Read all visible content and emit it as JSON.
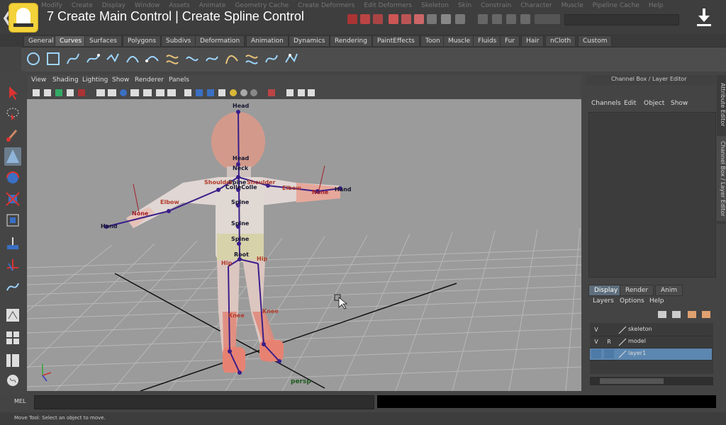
{
  "top_menu": [
    "Modify",
    "Create",
    "Display",
    "Window",
    "Assets",
    "Animate",
    "Geometry Cache",
    "Create Deformers",
    "Edit Deformers",
    "Skeleton",
    "Skin",
    "Constrain",
    "Character",
    "Muscle",
    "Pipeline Cache",
    "Help"
  ],
  "video": {
    "back_glyph": "❮",
    "title": "7  Create Main Control | Create Spline Control"
  },
  "shelf_tabs": [
    "General",
    "Curves",
    "Surfaces",
    "Polygons",
    "Subdivs",
    "Deformation",
    "Animation",
    "Dynamics",
    "Rendering",
    "PaintEffects",
    "Toon",
    "Muscle",
    "Fluids",
    "Fur",
    "Hair",
    "nCloth",
    "Custom"
  ],
  "active_shelf_tab": "Curves",
  "viewport": {
    "menu": [
      "View",
      "Shading",
      "Lighting",
      "Show",
      "Renderer",
      "Panels"
    ],
    "camera_label": "persp"
  },
  "joints": {
    "head_top": "Head",
    "head": "Head",
    "neck": "Neck",
    "spine1": "Spine",
    "collar": "ColleColle",
    "spine2": "Spine",
    "spine3": "Spine",
    "spine4": "Spine",
    "root": "Root",
    "shoulder_l": "Shoulder",
    "shoulder_r": "Shoulder",
    "elbow_l": "Elbow",
    "elbow_r": "Elbow",
    "none_l": "None",
    "none_r": "None",
    "hand_l": "Hand",
    "hand_r": "Hand",
    "hip_l": "Hip",
    "hip_r": "Hip",
    "knee_l": "Knee",
    "knee_r": "Knee"
  },
  "channel_box": {
    "title": "Channel Box / Layer Editor",
    "menu": [
      "Channels",
      "Edit",
      "Object",
      "Show"
    ]
  },
  "side_tabs": [
    "Attribute Editor",
    "Channel Box / Layer Editor"
  ],
  "layer_editor": {
    "tabs": [
      "Display",
      "Render",
      "Anim"
    ],
    "active_tab": "Display",
    "menu": [
      "Layers",
      "Options",
      "Help"
    ],
    "layers": [
      {
        "v": "V",
        "r": "",
        "name": "skeleton",
        "selected": false
      },
      {
        "v": "V",
        "r": "R",
        "name": "model",
        "selected": false
      },
      {
        "v": "",
        "r": "",
        "name": "layer1",
        "selected": true
      }
    ]
  },
  "mel_label": "MEL",
  "help_line": "Move Tool: Select an object to move."
}
